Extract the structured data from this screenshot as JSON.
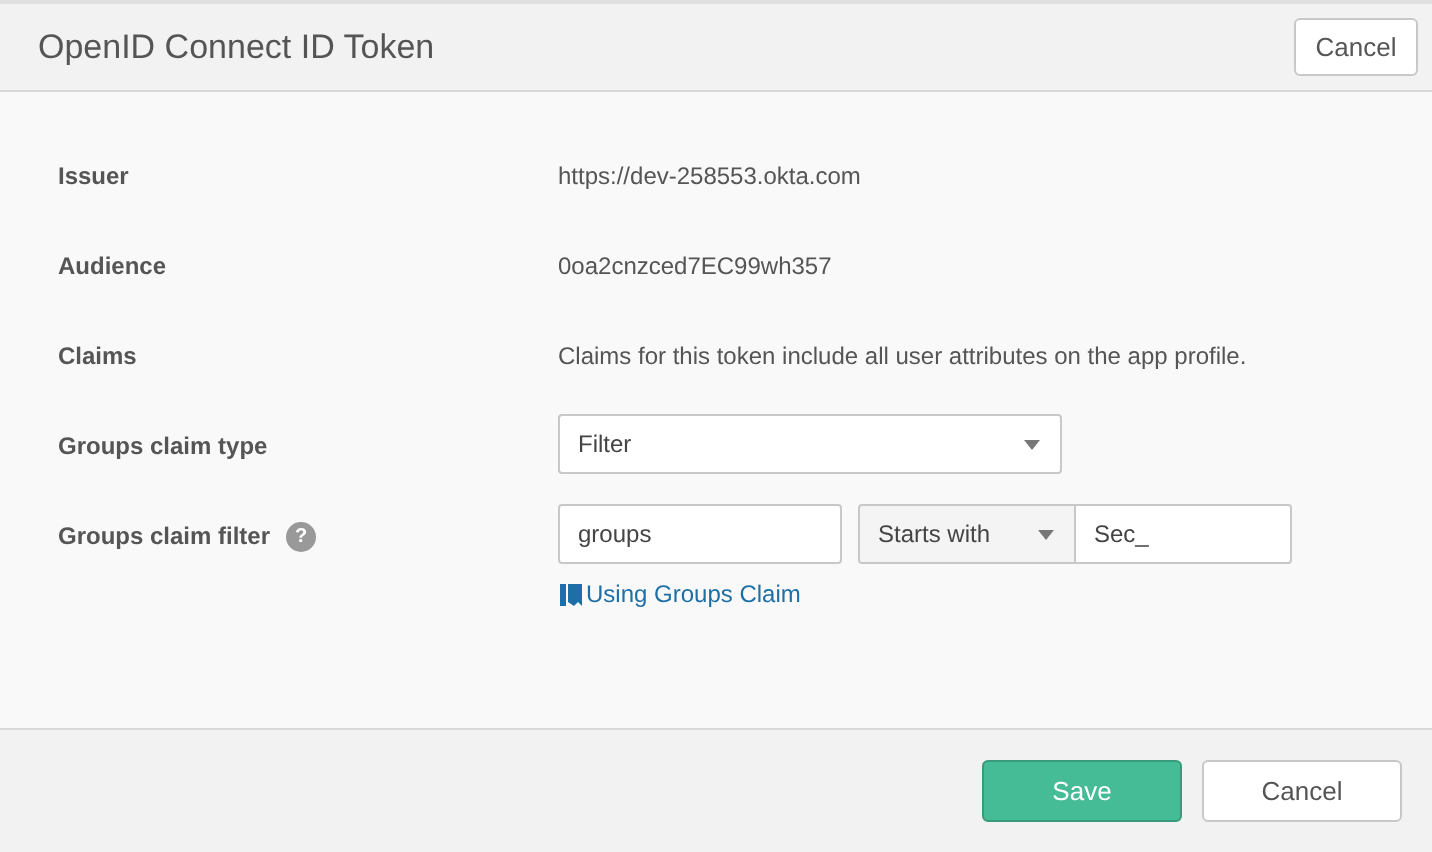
{
  "window": {
    "title": "OpenID Connect ID Token",
    "cancel": "Cancel"
  },
  "fields": [
    {
      "kind": "text",
      "label": "Issuer",
      "value": "https://dev-258553.okta.com"
    },
    {
      "kind": "text",
      "label": "Audience",
      "value": "0oa2cnzced7EC99wh357"
    },
    {
      "kind": "text",
      "label": "Claims",
      "value": "Claims for this token include all user attributes on the app profile."
    },
    {
      "kind": "select",
      "label": "Groups claim type",
      "value": "Filter"
    },
    {
      "kind": "filter",
      "label": "Groups claim filter",
      "help": "?",
      "name": "groups",
      "operator": "Starts with",
      "filter_value": "Sec_",
      "link": "Using Groups Claim"
    }
  ],
  "footer": {
    "save": "Save",
    "cancel": "Cancel"
  }
}
